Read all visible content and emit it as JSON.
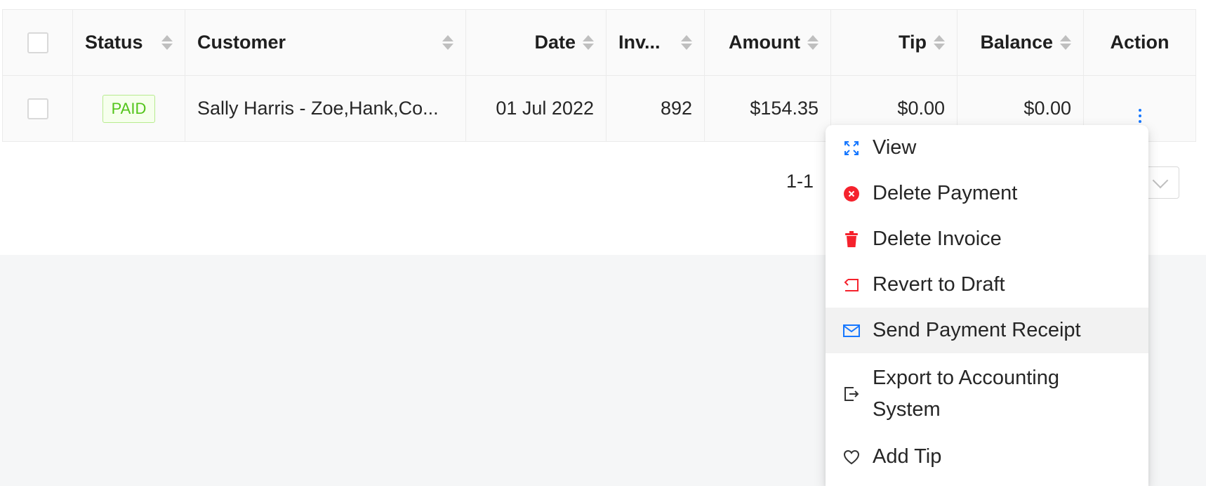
{
  "table": {
    "headers": {
      "status": "Status",
      "customer": "Customer",
      "date": "Date",
      "invoice": "Inv...",
      "amount": "Amount",
      "tip": "Tip",
      "balance": "Balance",
      "action": "Action"
    },
    "rows": [
      {
        "status": "PAID",
        "customer": "Sally Harris - Zoe,Hank,Co...",
        "date": "01 Jul 2022",
        "invoice": "892",
        "amount": "$154.35",
        "tip": "$0.00",
        "balance": "$0.00"
      }
    ]
  },
  "pagination": {
    "range": "1-1"
  },
  "action_menu": {
    "items": [
      {
        "label": "View",
        "icon": "expand-icon"
      },
      {
        "label": "Delete Payment",
        "icon": "close-circle-icon"
      },
      {
        "label": "Delete Invoice",
        "icon": "trash-icon"
      },
      {
        "label": "Revert to Draft",
        "icon": "revert-icon"
      },
      {
        "label": "Send Payment Receipt",
        "icon": "mail-icon"
      },
      {
        "label": "Export to Accounting System",
        "icon": "export-icon"
      },
      {
        "label": "Add Tip",
        "icon": "heart-icon"
      }
    ],
    "active_index": 4
  },
  "colors": {
    "paid_badge": "#52c41a",
    "danger": "#f5222d",
    "accent": "#1677ff"
  }
}
